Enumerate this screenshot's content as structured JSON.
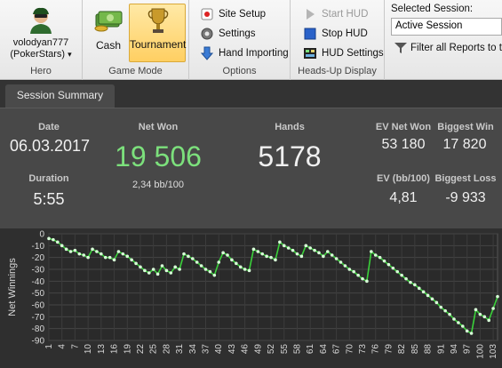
{
  "ribbon": {
    "hero": {
      "name_line1": "volodyan777",
      "name_line2": "(PokerStars)",
      "dropdown_glyph": "▾",
      "group_label": "Hero"
    },
    "game_mode": {
      "cash_label": "Cash",
      "tournament_label": "Tournament",
      "group_label": "Game Mode"
    },
    "options": {
      "site_setup": "Site Setup",
      "settings": "Settings",
      "hand_importing": "Hand Importing",
      "group_label": "Options"
    },
    "hud": {
      "start_hud": "Start HUD",
      "stop_hud": "Stop HUD",
      "hud_settings": "HUD Settings",
      "group_label": "Heads-Up Display"
    },
    "session": {
      "title": "Selected Session:",
      "selected": "Active Session",
      "filter_label": "Filter all Reports to th"
    }
  },
  "tabs": {
    "session_summary": "Session Summary"
  },
  "summary": {
    "date_label": "Date",
    "date": "06.03.2017",
    "duration_label": "Duration",
    "duration": "5:55",
    "net_won_label": "Net Won",
    "net_won": "19 506",
    "bb_per_100": "2,34 bb/100",
    "hands_label": "Hands",
    "hands": "5178",
    "ev_net_won_label": "EV Net Won",
    "ev_net_won": "53 180",
    "biggest_win_label": "Biggest Win",
    "biggest_win": "17 820",
    "ev_bb100_label": "EV (bb/100)",
    "ev_bb100": "4,81",
    "biggest_loss_label": "Biggest Loss",
    "biggest_loss": "-9 933"
  },
  "colors": {
    "net_won": "#7ce07c",
    "line": "#3ad13a",
    "points": "#d8ffd8",
    "active_mode": "#ffd56f"
  },
  "chart_data": {
    "type": "line",
    "ylabel": "Net Winnings",
    "ylim": [
      -90,
      0
    ],
    "yticks": [
      0,
      -10,
      -20,
      -30,
      -40,
      -50,
      -60,
      -70,
      -80,
      -90
    ],
    "xlim": [
      1,
      104
    ],
    "xticks": [
      1,
      4,
      7,
      10,
      13,
      16,
      19,
      22,
      25,
      28,
      31,
      34,
      37,
      40,
      43,
      46,
      49,
      52,
      55,
      58,
      61,
      64,
      67,
      70,
      73,
      76,
      79,
      82,
      85,
      88,
      91,
      94,
      97,
      100,
      103
    ],
    "grid": true,
    "series": [
      {
        "x": [
          1,
          2,
          3,
          4,
          5,
          6,
          7,
          8,
          9,
          10,
          11,
          12,
          13,
          14,
          15,
          16,
          17,
          18,
          19,
          20,
          21,
          22,
          23,
          24,
          25,
          26,
          27,
          28,
          29,
          30,
          31,
          32,
          33,
          34,
          35,
          36,
          37,
          38,
          39,
          40,
          41,
          42,
          43,
          44,
          45,
          46,
          47,
          48,
          49,
          50,
          51,
          52,
          53,
          54,
          55,
          56,
          57,
          58,
          59,
          60,
          61,
          62,
          63,
          64,
          65,
          66,
          67,
          68,
          69,
          70,
          71,
          72,
          73,
          74,
          75,
          76,
          77,
          78,
          79,
          80,
          81,
          82,
          83,
          84,
          85,
          86,
          87,
          88,
          89,
          90,
          91,
          92,
          93,
          94,
          95,
          96,
          97,
          98,
          99,
          100,
          101,
          102,
          103,
          104
        ],
        "values": [
          -4,
          -5,
          -7,
          -10,
          -13,
          -15,
          -14,
          -17,
          -18,
          -20,
          -13,
          -15,
          -17,
          -20,
          -20,
          -22,
          -15,
          -17,
          -19,
          -22,
          -25,
          -28,
          -31,
          -33,
          -30,
          -34,
          -27,
          -31,
          -33,
          -28,
          -30,
          -17,
          -19,
          -21,
          -24,
          -27,
          -30,
          -32,
          -35,
          -24,
          -16,
          -18,
          -22,
          -25,
          -28,
          -30,
          -31,
          -13,
          -15,
          -17,
          -19,
          -20,
          -22,
          -7,
          -10,
          -12,
          -14,
          -17,
          -19,
          -10,
          -12,
          -14,
          -16,
          -19,
          -15,
          -18,
          -21,
          -24,
          -27,
          -30,
          -32,
          -35,
          -38,
          -40,
          -15,
          -18,
          -20,
          -23,
          -26,
          -29,
          -32,
          -35,
          -38,
          -41,
          -43,
          -46,
          -49,
          -52,
          -55,
          -58,
          -62,
          -65,
          -68,
          -72,
          -75,
          -78,
          -82,
          -84,
          -64,
          -68,
          -70,
          -73,
          -63,
          -53
        ]
      }
    ]
  }
}
